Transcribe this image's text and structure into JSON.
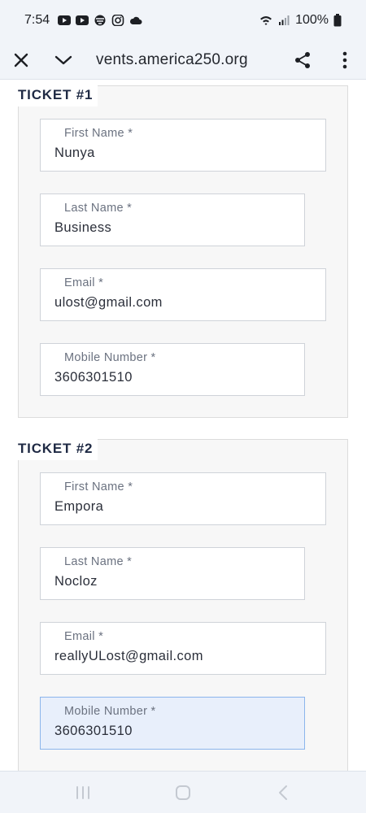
{
  "status_bar": {
    "time": "7:54",
    "battery": "100%",
    "icons": [
      "youtube-icon",
      "youtube-icon",
      "app-icon",
      "instagram-icon",
      "cloud-icon",
      "wifi-icon",
      "signal-icon",
      "battery-icon"
    ]
  },
  "url_bar": {
    "url": "vents.america250.org",
    "icons": [
      "close-icon",
      "chevron-down-icon",
      "share-icon",
      "more-vert-icon"
    ]
  },
  "tickets": [
    {
      "title": "TICKET #1",
      "fields": [
        {
          "label": "First Name *",
          "value": "Nunya"
        },
        {
          "label": "Last Name *",
          "value": "Business"
        },
        {
          "label": "Email *",
          "value": "ulost@gmail.com"
        },
        {
          "label": "Mobile Number *",
          "value": "3606301510"
        }
      ]
    },
    {
      "title": "TICKET #2",
      "fields": [
        {
          "label": "First Name *",
          "value": "Empora"
        },
        {
          "label": "Last Name *",
          "value": "Nocloz"
        },
        {
          "label": "Email *",
          "value": "reallyULost@gmail.com"
        },
        {
          "label": "Mobile Number *",
          "value": "3606301510"
        }
      ]
    }
  ],
  "nav_bar": {
    "icons": [
      "recents-icon",
      "home-icon",
      "back-icon"
    ]
  },
  "colors": {
    "chrome_bg": "#f1f4f9",
    "ticket_title": "#1f2a44",
    "focused_field_bg": "#e8effb",
    "focused_field_border": "#8bb5ec"
  }
}
